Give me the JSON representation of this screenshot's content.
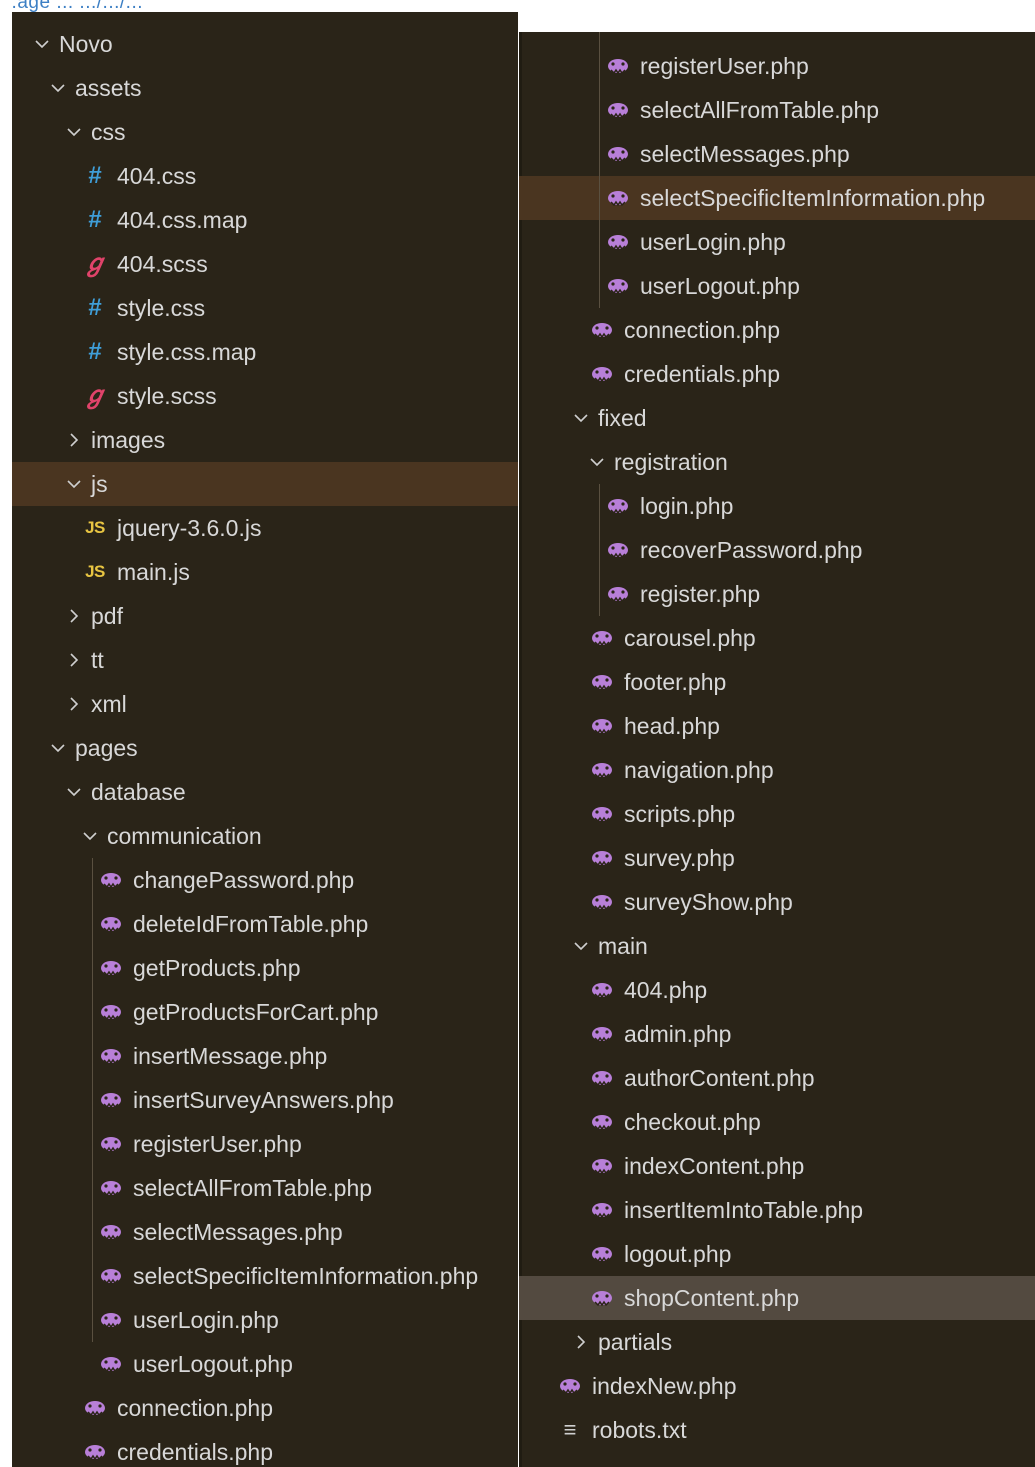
{
  "explorer": {
    "top_cut_text": "...age ... .../.../...",
    "colors": {
      "background": "#2a2418",
      "selected_row": "#4a3520",
      "hovered_row": "#534a40",
      "text": "#d8d8d8",
      "css_icon": "#3f9ed8",
      "js_icon": "#e8c542",
      "scss_icon": "#e0436a",
      "php_icon": "#b87fd8"
    },
    "left_tree": [
      {
        "type": "folder",
        "open": true,
        "depth": 0,
        "label": "Novo"
      },
      {
        "type": "folder",
        "open": true,
        "depth": 1,
        "label": "assets"
      },
      {
        "type": "folder",
        "open": true,
        "depth": 2,
        "label": "css"
      },
      {
        "type": "file",
        "icon": "css",
        "depth": 3,
        "label": "404.css"
      },
      {
        "type": "file",
        "icon": "css",
        "depth": 3,
        "label": "404.css.map"
      },
      {
        "type": "file",
        "icon": "scss",
        "depth": 3,
        "label": "404.scss"
      },
      {
        "type": "file",
        "icon": "css",
        "depth": 3,
        "label": "style.css"
      },
      {
        "type": "file",
        "icon": "css",
        "depth": 3,
        "label": "style.css.map"
      },
      {
        "type": "file",
        "icon": "scss",
        "depth": 3,
        "label": "style.scss"
      },
      {
        "type": "folder",
        "open": false,
        "depth": 2,
        "label": "images"
      },
      {
        "type": "folder",
        "open": true,
        "depth": 2,
        "label": "js",
        "state": "selected"
      },
      {
        "type": "file",
        "icon": "js",
        "depth": 3,
        "label": "jquery-3.6.0.js"
      },
      {
        "type": "file",
        "icon": "js",
        "depth": 3,
        "label": "main.js"
      },
      {
        "type": "folder",
        "open": false,
        "depth": 2,
        "label": "pdf"
      },
      {
        "type": "folder",
        "open": false,
        "depth": 2,
        "label": "tt"
      },
      {
        "type": "folder",
        "open": false,
        "depth": 2,
        "label": "xml"
      },
      {
        "type": "folder",
        "open": true,
        "depth": 1,
        "label": "pages"
      },
      {
        "type": "folder",
        "open": true,
        "depth": 2,
        "label": "database"
      },
      {
        "type": "folder",
        "open": true,
        "depth": 3,
        "label": "communication"
      },
      {
        "type": "file",
        "icon": "php",
        "depth": 4,
        "label": "changePassword.php"
      },
      {
        "type": "file",
        "icon": "php",
        "depth": 4,
        "label": "deleteIdFromTable.php"
      },
      {
        "type": "file",
        "icon": "php",
        "depth": 4,
        "label": "getProducts.php"
      },
      {
        "type": "file",
        "icon": "php",
        "depth": 4,
        "label": "getProductsForCart.php"
      },
      {
        "type": "file",
        "icon": "php",
        "depth": 4,
        "label": "insertMessage.php"
      },
      {
        "type": "file",
        "icon": "php",
        "depth": 4,
        "label": "insertSurveyAnswers.php"
      },
      {
        "type": "file",
        "icon": "php",
        "depth": 4,
        "label": "registerUser.php"
      },
      {
        "type": "file",
        "icon": "php",
        "depth": 4,
        "label": "selectAllFromTable.php"
      },
      {
        "type": "file",
        "icon": "php",
        "depth": 4,
        "label": "selectMessages.php"
      },
      {
        "type": "file",
        "icon": "php",
        "depth": 4,
        "label": "selectSpecificItemInformation.php"
      },
      {
        "type": "file",
        "icon": "php",
        "depth": 4,
        "label": "userLogin.php"
      },
      {
        "type": "file",
        "icon": "php",
        "depth": 4,
        "label": "userLogout.php"
      },
      {
        "type": "file",
        "icon": "php",
        "depth": 3,
        "label": "connection.php"
      },
      {
        "type": "file",
        "icon": "php",
        "depth": 3,
        "label": "credentials.php"
      }
    ],
    "right_tree": [
      {
        "type": "file",
        "icon": "php",
        "depth": 4,
        "label": "registerUser.php"
      },
      {
        "type": "file",
        "icon": "php",
        "depth": 4,
        "label": "selectAllFromTable.php"
      },
      {
        "type": "file",
        "icon": "php",
        "depth": 4,
        "label": "selectMessages.php"
      },
      {
        "type": "file",
        "icon": "php",
        "depth": 4,
        "label": "selectSpecificItemInformation.php",
        "state": "selected"
      },
      {
        "type": "file",
        "icon": "php",
        "depth": 4,
        "label": "userLogin.php"
      },
      {
        "type": "file",
        "icon": "php",
        "depth": 4,
        "label": "userLogout.php"
      },
      {
        "type": "file",
        "icon": "php",
        "depth": 3,
        "label": "connection.php"
      },
      {
        "type": "file",
        "icon": "php",
        "depth": 3,
        "label": "credentials.php"
      },
      {
        "type": "folder",
        "open": true,
        "depth": 2,
        "label": "fixed"
      },
      {
        "type": "folder",
        "open": true,
        "depth": 3,
        "label": "registration"
      },
      {
        "type": "file",
        "icon": "php",
        "depth": 4,
        "label": "login.php"
      },
      {
        "type": "file",
        "icon": "php",
        "depth": 4,
        "label": "recoverPassword.php"
      },
      {
        "type": "file",
        "icon": "php",
        "depth": 4,
        "label": "register.php"
      },
      {
        "type": "file",
        "icon": "php",
        "depth": 3,
        "label": "carousel.php"
      },
      {
        "type": "file",
        "icon": "php",
        "depth": 3,
        "label": "footer.php"
      },
      {
        "type": "file",
        "icon": "php",
        "depth": 3,
        "label": "head.php"
      },
      {
        "type": "file",
        "icon": "php",
        "depth": 3,
        "label": "navigation.php"
      },
      {
        "type": "file",
        "icon": "php",
        "depth": 3,
        "label": "scripts.php"
      },
      {
        "type": "file",
        "icon": "php",
        "depth": 3,
        "label": "survey.php"
      },
      {
        "type": "file",
        "icon": "php",
        "depth": 3,
        "label": "surveyShow.php"
      },
      {
        "type": "folder",
        "open": true,
        "depth": 2,
        "label": "main"
      },
      {
        "type": "file",
        "icon": "php",
        "depth": 3,
        "label": "404.php"
      },
      {
        "type": "file",
        "icon": "php",
        "depth": 3,
        "label": "admin.php"
      },
      {
        "type": "file",
        "icon": "php",
        "depth": 3,
        "label": "authorContent.php"
      },
      {
        "type": "file",
        "icon": "php",
        "depth": 3,
        "label": "checkout.php"
      },
      {
        "type": "file",
        "icon": "php",
        "depth": 3,
        "label": "indexContent.php"
      },
      {
        "type": "file",
        "icon": "php",
        "depth": 3,
        "label": "insertItemIntoTable.php"
      },
      {
        "type": "file",
        "icon": "php",
        "depth": 3,
        "label": "logout.php"
      },
      {
        "type": "file",
        "icon": "php",
        "depth": 3,
        "label": "shopContent.php",
        "state": "hovered"
      },
      {
        "type": "folder",
        "open": false,
        "depth": 2,
        "label": "partials"
      },
      {
        "type": "file",
        "icon": "php",
        "depth": 1,
        "label": "indexNew.php"
      },
      {
        "type": "file",
        "icon": "txt",
        "depth": 1,
        "label": "robots.txt"
      }
    ]
  }
}
